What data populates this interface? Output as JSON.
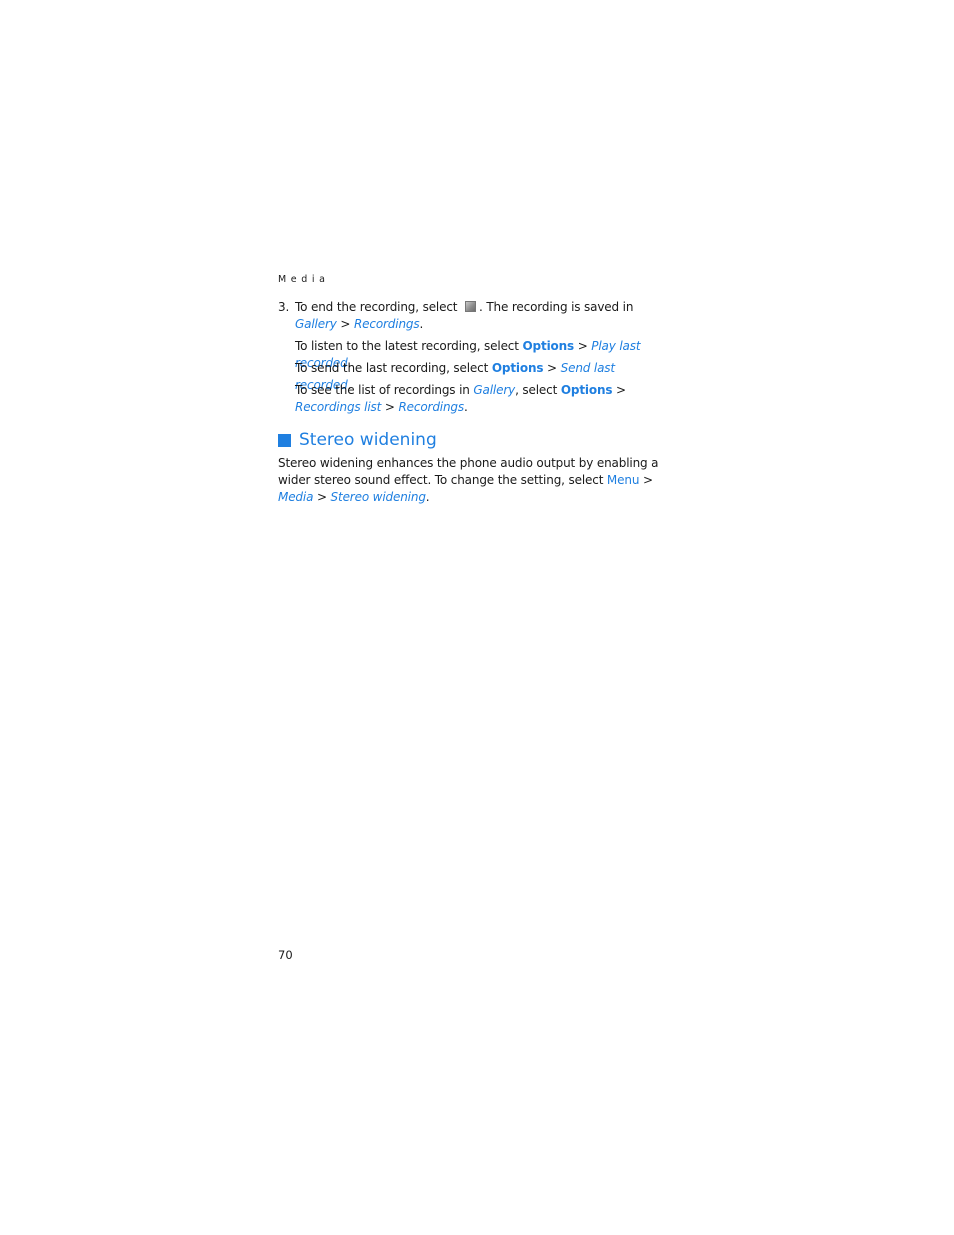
{
  "running_head": "Media",
  "step": {
    "number": "3.",
    "text_before_icon": "To end the recording, select",
    "icon": "stop-icon",
    "text_after_icon": ". The recording is saved in",
    "path": [
      "Gallery",
      "Recordings"
    ],
    "separator": ">",
    "end": "."
  },
  "paragraphs": [
    {
      "intro": "To listen to the latest recording, select",
      "menu": "Options",
      "item": "Play last recorded",
      "end": "."
    },
    {
      "intro": "To send the last recording, select",
      "menu": "Options",
      "item": "Send last recorded",
      "end": "."
    },
    {
      "intro": "To see the list of recordings in",
      "location": "Gallery",
      "mid": ", select",
      "menu": "Options",
      "item": "Recordings list",
      "item2": "Recordings",
      "end": "."
    }
  ],
  "section": {
    "heading": "Stereo widening",
    "body_text": "Stereo widening enhances the phone audio output by enabling a wider stereo sound effect. To change the setting, select",
    "menu": "Menu",
    "path1": "Media",
    "path2": "Stereo widening",
    "separator": ">",
    "end": "."
  },
  "page_number": "70",
  "colors": {
    "link_blue": "#1f7fe0",
    "text": "#1a1a1a"
  }
}
